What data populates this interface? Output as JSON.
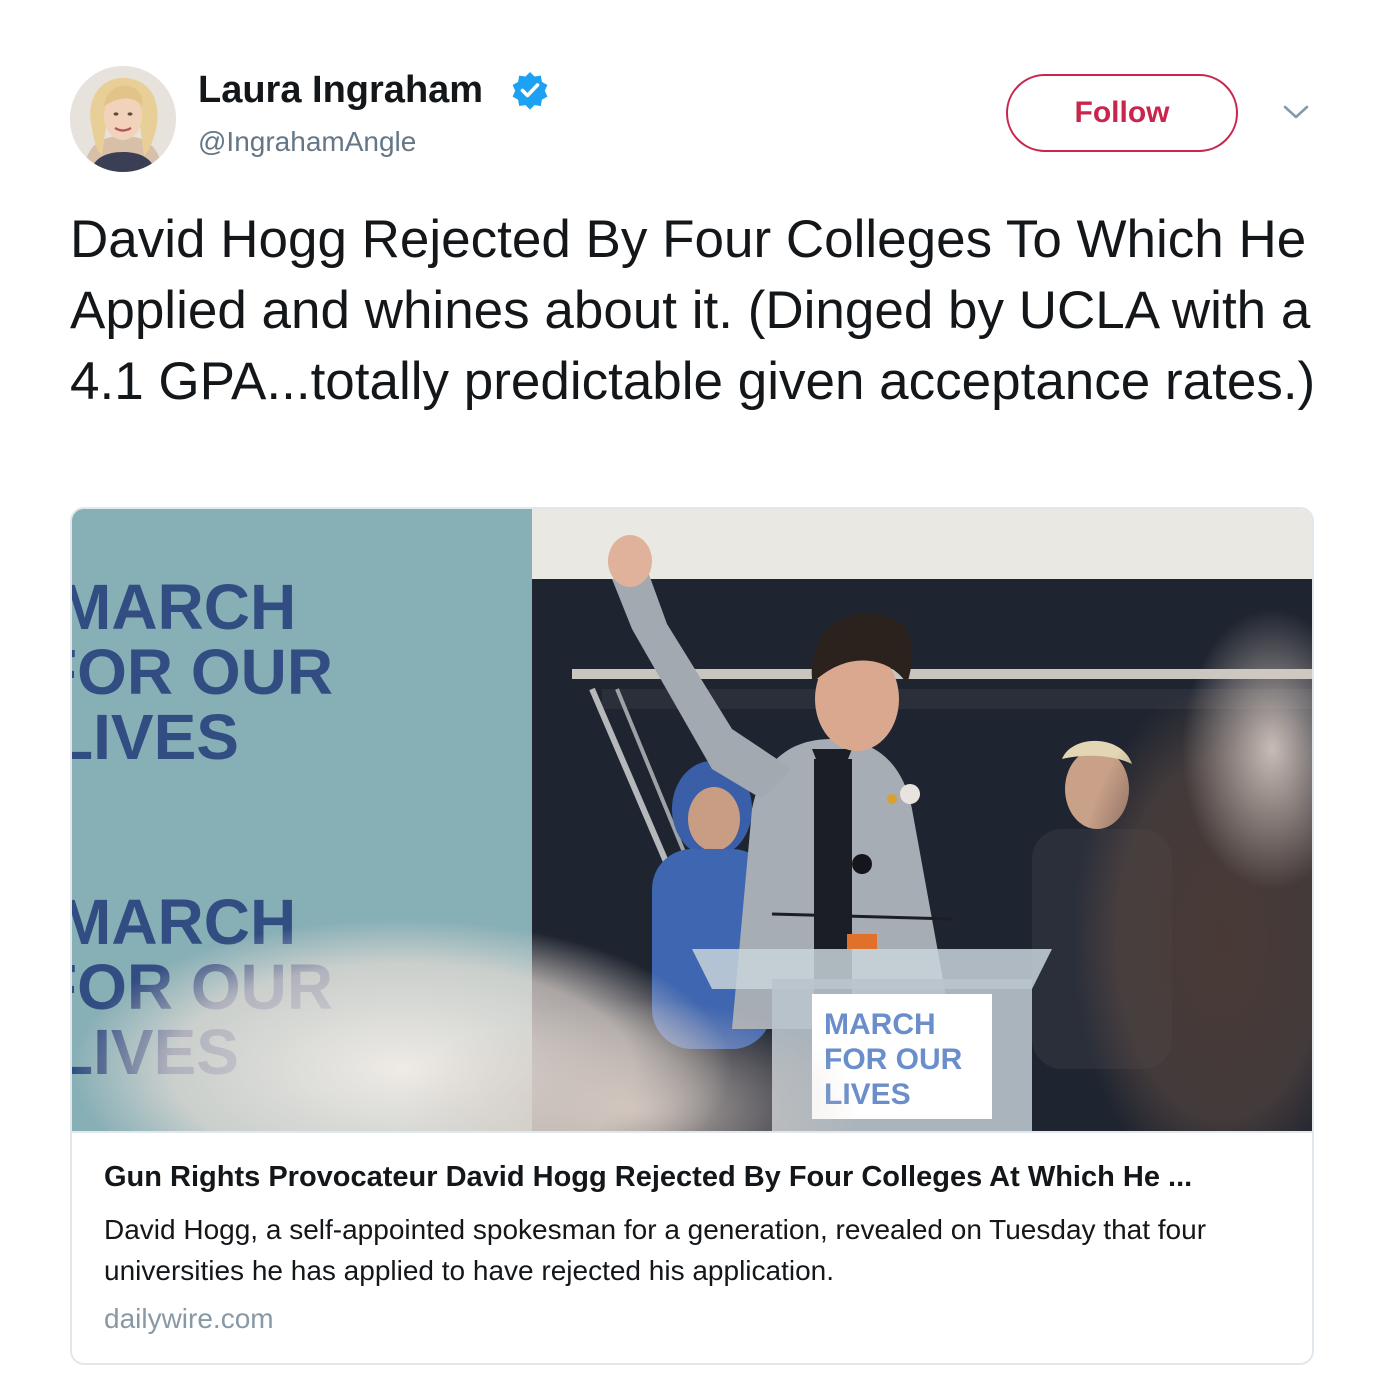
{
  "author": {
    "display_name": "Laura Ingraham",
    "handle": "@IngrahamAngle",
    "verified_icon": "verified-badge-icon",
    "avatar_icon": "profile-photo"
  },
  "actions": {
    "follow_label": "Follow",
    "menu_icon": "chevron-down-icon"
  },
  "tweet": {
    "text": "David Hogg Rejected By Four Colleges To Which He Applied and whines about it. (Dinged by UCLA with a 4.1 GPA...totally predictable given acceptance rates.)"
  },
  "card": {
    "image": {
      "sign_text": [
        "MARCH",
        "FOR OUR",
        "LIVES"
      ]
    },
    "title": "Gun Rights Provocateur David Hogg Rejected By Four Colleges At Which He ...",
    "description": "David Hogg, a self-appointed spokesman for a generation, revealed on Tuesday that four universities he has applied to have rejected his application.",
    "domain": "dailywire.com"
  },
  "colors": {
    "follow_accent": "#c9254d",
    "verified_blue": "#1da1f2",
    "secondary_text": "#657786",
    "domain_text": "#8899a6",
    "border": "#e1e8ed"
  }
}
